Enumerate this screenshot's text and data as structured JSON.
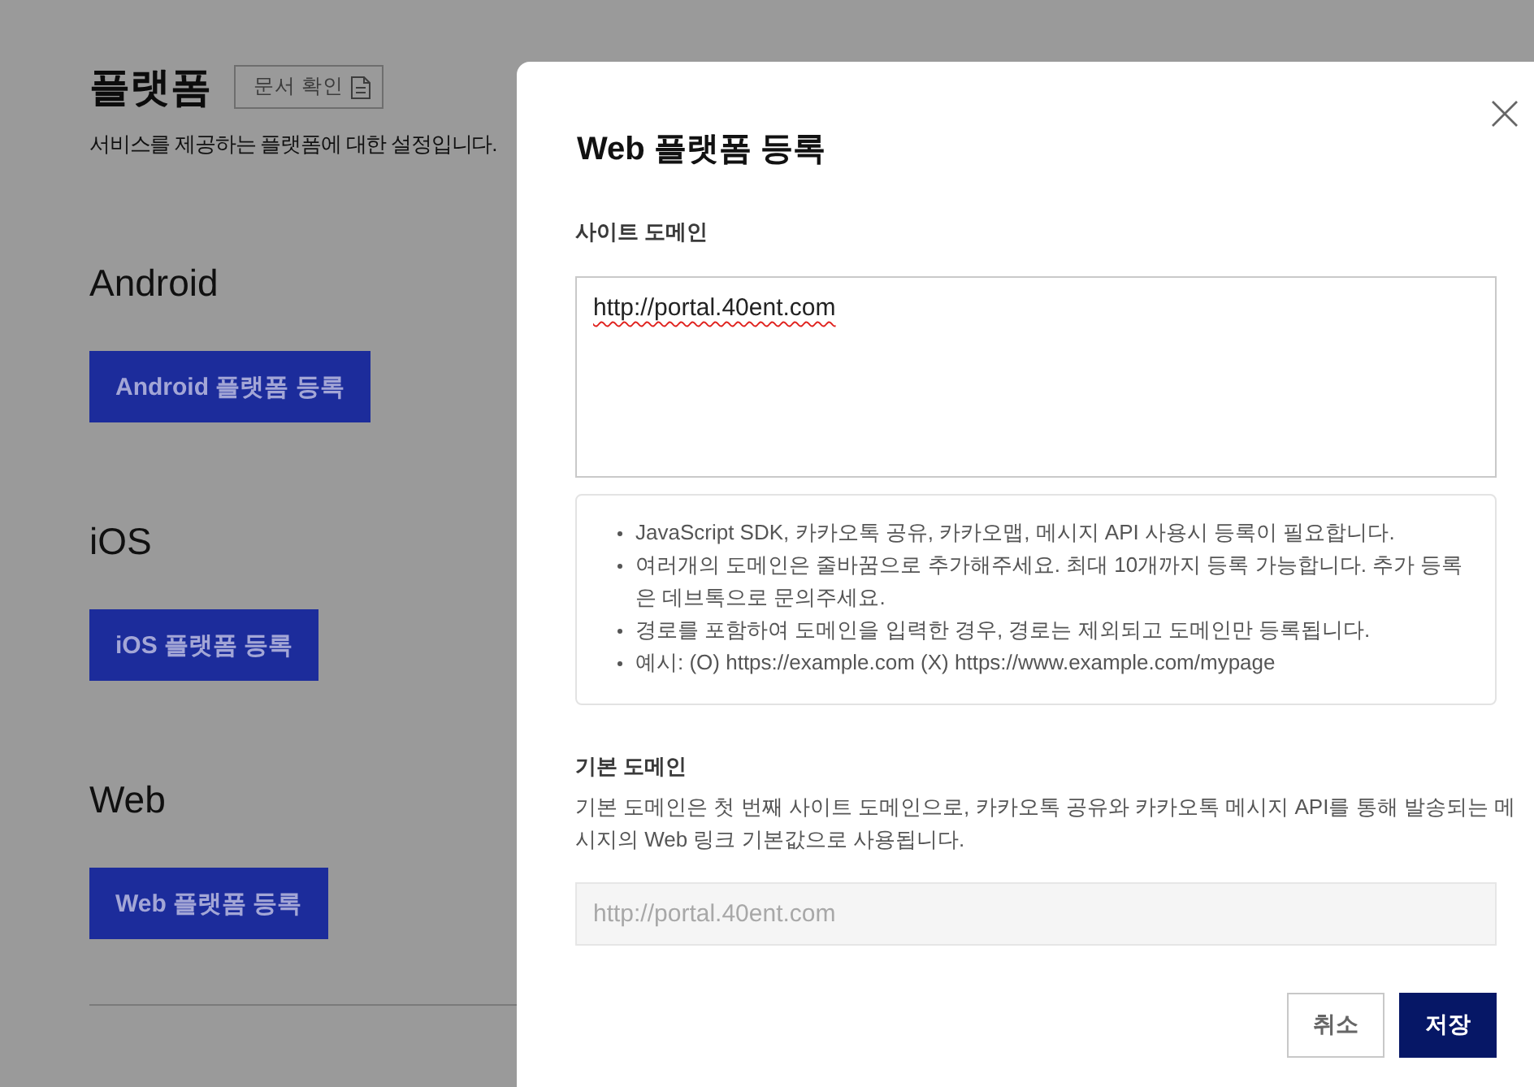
{
  "page": {
    "title": "플랫폼",
    "docs_button": {
      "label": "문서 확인"
    },
    "description": "서비스를 제공하는 플랫폼에 대한 설정입니다."
  },
  "platforms": [
    {
      "heading": "Android",
      "button": "Android 플랫폼 등록"
    },
    {
      "heading": "iOS",
      "button": "iOS 플랫폼 등록"
    },
    {
      "heading": "Web",
      "button": "Web 플랫폼 등록"
    }
  ],
  "dialog": {
    "title": "Web 플랫폼 등록",
    "site_domain": {
      "label": "사이트 도메인",
      "value": "http://portal.40ent.com",
      "spelling_flagged": true
    },
    "notes": [
      "JavaScript SDK, 카카오톡 공유, 카카오맵, 메시지 API 사용시 등록이 필요합니다.",
      "여러개의 도메인은 줄바꿈으로 추가해주세요. 최대 10개까지 등록 가능합니다. 추가 등록은 데브톡으로 문의주세요.",
      "경로를 포함하여 도메인을 입력한 경우, 경로는 제외되고 도메인만 등록됩니다.",
      "예시: (O) https://example.com (X) https://www.example.com/mypage"
    ],
    "default_domain": {
      "label": "기본 도메인",
      "description": "기본 도메인은 첫 번째 사이트 도메인으로, 카카오톡 공유와 카카오톡 메시지 API를 통해 발송되는 메시지의 Web 링크 기본값으로 사용됩니다.",
      "value": "http://portal.40ent.com",
      "disabled": true
    },
    "buttons": [
      {
        "label": "취소",
        "kind": "secondary"
      },
      {
        "label": "저장",
        "kind": "primary"
      }
    ]
  }
}
